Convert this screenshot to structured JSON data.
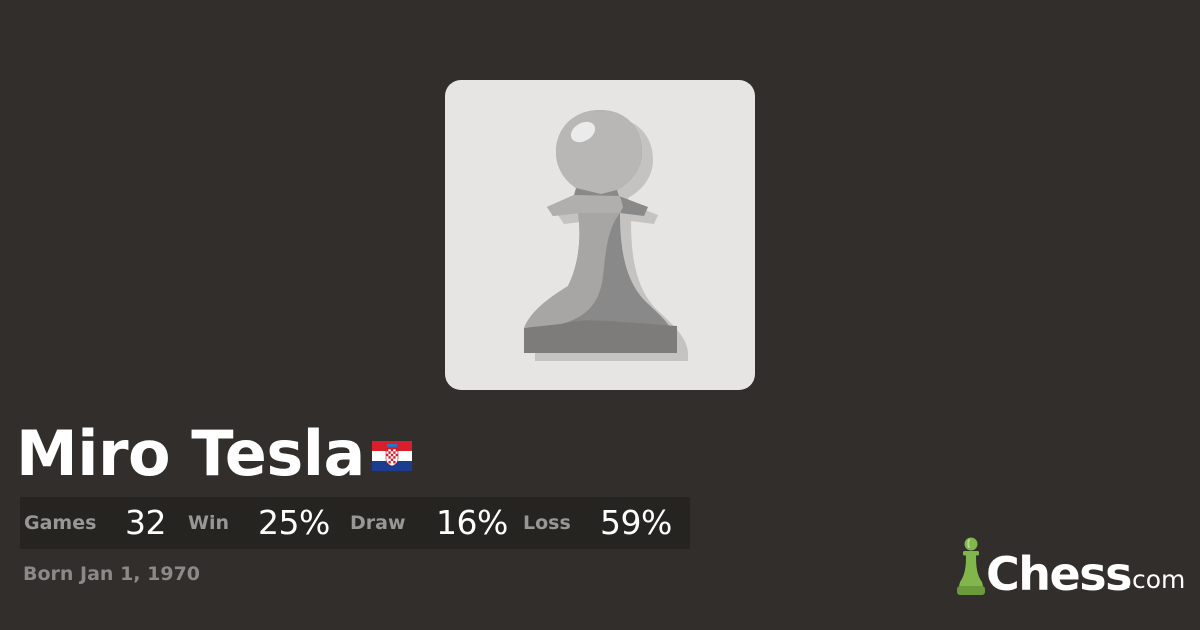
{
  "profile": {
    "name": "Miro Tesla",
    "avatar_icon": "pawn-icon",
    "flag_icon": "croatia-flag-icon",
    "born": "Born Jan 1, 1970"
  },
  "stats": {
    "games_label": "Games",
    "games_value": "32",
    "win_label": "Win",
    "win_value": "25%",
    "draw_label": "Draw",
    "draw_value": "16%",
    "loss_label": "Loss",
    "loss_value": "59%"
  },
  "brand": {
    "name": "Chess",
    "suffix": ".com",
    "icon": "pawn-logo-icon",
    "color": "#81b64c"
  },
  "colors": {
    "background": "#312e2b",
    "stats_bar": "#262421",
    "avatar_card": "#e6e5e3",
    "label_gray": "#989795"
  }
}
